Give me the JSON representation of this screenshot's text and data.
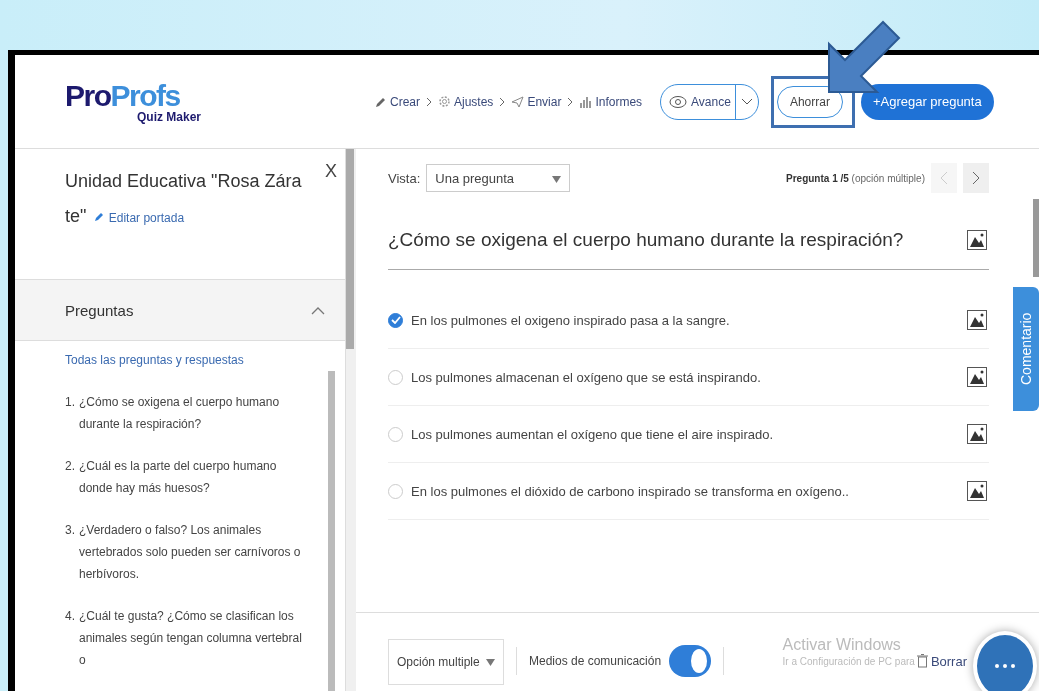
{
  "header": {
    "logo": {
      "brand_dark": "Pro",
      "brand_light": "Profs",
      "product": "Quiz Maker"
    },
    "steps": [
      {
        "label": "Crear"
      },
      {
        "label": "Ajustes"
      },
      {
        "label": "Enviar"
      },
      {
        "label": "Informes"
      }
    ],
    "preview_button": "Avance",
    "save_button": "Ahorrar",
    "add_button": "+Agregar pregunta"
  },
  "sidebar": {
    "title_line1": "Unidad Educativa \"Rosa Zára",
    "title_line2": "te\"",
    "edit_link": "Editar portada",
    "close": "X",
    "section": {
      "title": "Preguntas",
      "expanded": true
    },
    "all_link": "Todas las preguntas y respuestas",
    "questions": [
      {
        "number": "1.",
        "text": "¿Cómo se oxigena el cuerpo humano durante la respiración?"
      },
      {
        "number": "2.",
        "text": "¿Cuál es la parte del cuerpo humano donde hay más huesos?"
      },
      {
        "number": "3.",
        "text": "¿Verdadero o falso? Los animales vertebrados solo pueden ser carnívoros o herbívoros."
      },
      {
        "number": "4.",
        "text": "¿Cuál te gusta? ¿Cómo se clasifican los animales según tengan columna vertebral o"
      }
    ]
  },
  "main": {
    "view_label": "Vista:",
    "view_value": "Una pregunta",
    "counter_bold": "Pregunta 1 /5",
    "counter_type": "(opción múltiple)",
    "question": "¿Cómo se oxigena el cuerpo humano durante la respiración?",
    "options": [
      {
        "text": "En los pulmones el oxigeno inspirado pasa a la sangre.",
        "selected": true
      },
      {
        "text": "Los pulmones almacenan el oxígeno que se está inspirando.",
        "selected": false
      },
      {
        "text": "Los pulmones aumentan el oxígeno que tiene el aire inspirado.",
        "selected": false
      },
      {
        "text": "En los pulmones el dióxido de carbono inspirado se transforma en oxígeno..",
        "selected": false
      }
    ],
    "toolbar": {
      "type_value": "Opción multiple",
      "media_label": "Medios de comunicación",
      "media_on": true,
      "delete": "Borrar"
    },
    "comment_tab": "Comentario"
  },
  "os_notice": {
    "title": "Activar Windows",
    "text": "Ir a Configuración de PC para"
  }
}
